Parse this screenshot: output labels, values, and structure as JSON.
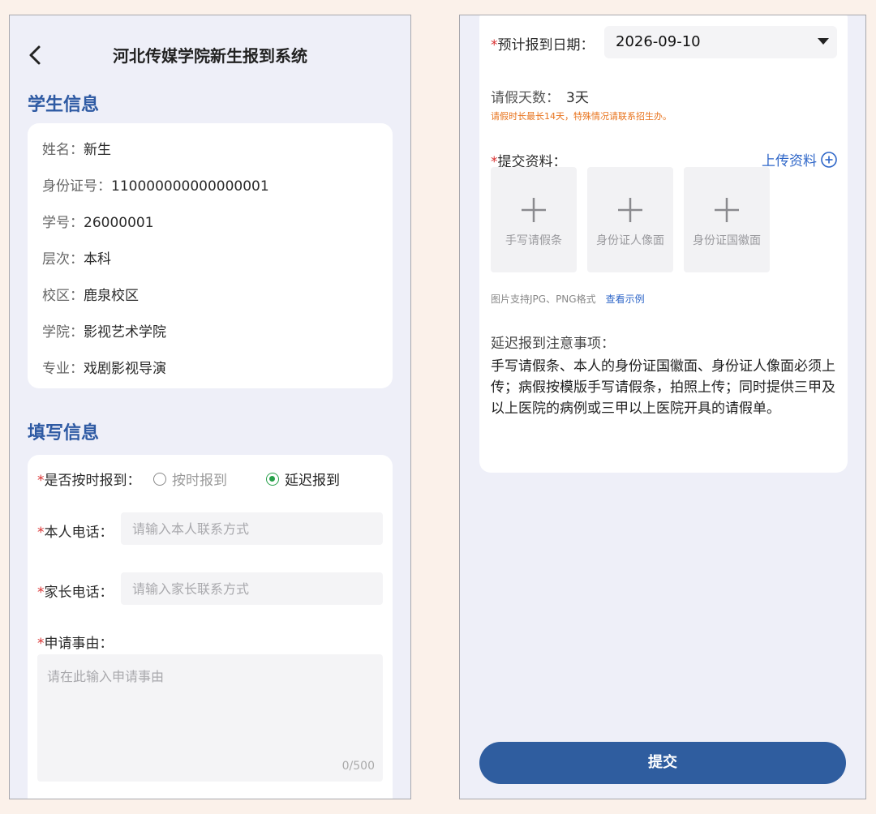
{
  "left": {
    "header": {
      "title": "河北传媒学院新生报到系统"
    },
    "student_info": {
      "title": "学生信息",
      "rows": [
        {
          "key": "姓名：",
          "value": "新生"
        },
        {
          "key": "身份证号：",
          "value": "110000000000000001"
        },
        {
          "key": "学号：",
          "value": "26000001"
        },
        {
          "key": "层次：",
          "value": "本科"
        },
        {
          "key": "校区：",
          "value": "鹿泉校区"
        },
        {
          "key": "学院：",
          "value": "影视艺术学院"
        },
        {
          "key": "专业：",
          "value": "戏剧影视导演"
        }
      ]
    },
    "form": {
      "title": "填写信息",
      "ontime_label": "是否按时报到：",
      "option_ontime": "按时报到",
      "option_delay": "延迟报到",
      "selected_option": "延迟报到",
      "phone_label": "本人电话：",
      "phone_placeholder": "请输入本人联系方式",
      "parent_label": "家长电话：",
      "parent_placeholder": "请输入家长联系方式",
      "reason_label": "申请事由：",
      "reason_placeholder": "请在此输入申请事由",
      "reason_counter": "0/500",
      "required_mark": "*"
    }
  },
  "right": {
    "date_label": "预计报到日期：",
    "date_value": "2026-09-10",
    "leave_days_label": "请假天数：",
    "leave_days_value": "3天",
    "leave_note": "请假时长最长14天，特殊情况请联系招生办。",
    "materials_label": "提交资料：",
    "upload_link": "上传资料",
    "tiles": [
      "手写请假条",
      "身份证人像面",
      "身份证国徽面"
    ],
    "format_hint": "图片支持JPG、PNG格式",
    "example_link": "查看示例",
    "notice_title": "延迟报到注意事项：",
    "notice_body": "手写请假条、本人的身份证国徽面、身份证人像面必须上传；病假按模版手写请假条，拍照上传；同时提供三甲及以上医院的病例或三甲以上医院开具的请假单。",
    "submit": "提交",
    "required_mark": "*"
  },
  "colors": {
    "accent_blue": "#2e5aa3",
    "button_blue": "#2f5d9f",
    "link_blue": "#2e66c8",
    "required_red": "#d93030",
    "radio_green": "#27a04a",
    "warning_orange": "#e8731c"
  },
  "icons": [
    "chevron-left-icon",
    "radio-icon",
    "dropdown-caret-icon",
    "plus-circle-icon",
    "plus-icon"
  ]
}
